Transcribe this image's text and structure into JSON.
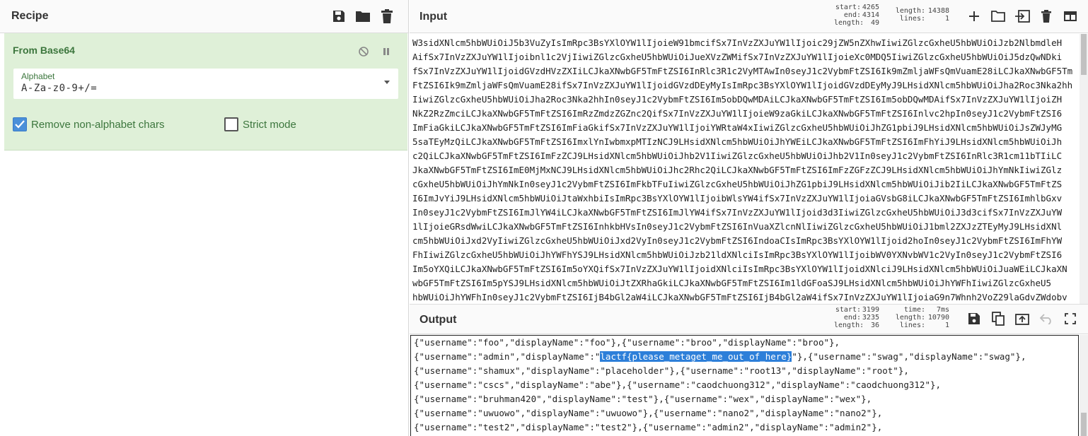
{
  "recipe": {
    "title": "Recipe",
    "actions": [
      "save-icon",
      "folder-icon",
      "trash-icon"
    ]
  },
  "operation": {
    "title": "From Base64",
    "alphabet_label": "Alphabet",
    "alphabet_value": "A-Za-z0-9+/=",
    "remove_label": "Remove non-alphabet chars",
    "remove_checked": true,
    "strict_label": "Strict mode",
    "strict_checked": false
  },
  "input": {
    "title": "Input",
    "stats": {
      "start_k": "start:",
      "start_v": "4265",
      "end_k": "end:",
      "end_v": "4314",
      "length_k": "length:",
      "length_v": "49",
      "tlength_k": "length:",
      "tlength_v": "14388",
      "lines_k": "lines:",
      "lines_v": "1"
    },
    "lines": [
      "W3sidXNlcm5hbWUiOiJ5b3VuZyIsImRpc3BsYXlOYW1lIjoieW91bmcifSx7InVzZXJuYW1lIjoic29jZW5nZXhwIiwiZGlzcGxheU5hbWUiOiJzb2NlbmdleH",
      "AifSx7InVzZXJuYW1lIjoibnl1c2VjIiwiZGlzcGxheU5hbWUiOiJueXVzZWMifSx7InVzZXJuYW1lIjoieXc0MDQ5IiwiZGlzcGxheU5hbWUiOiJ5dzQwNDki",
      "fSx7InVzZXJuYW1lIjoidGVzdHVzZXIiLCJkaXNwbGF5TmFtZSI6InRlc3R1c2VyMTAwIn0seyJ1c2VybmFtZSI6Ik9mZmljaWFsQmVuamE28iLCJkaXNwbGF5Tm",
      "FtZSI6Ik9mZmljaWFsQmVuamE28ifSx7InVzZXJuYW1lIjoidGVzdDEyMyIsImRpc3BsYXlOYW1lIjoidGVzdDEyMyJ9LHsidXNlcm5hbWUiOiJha2Roc3Nka2hh",
      "IiwiZGlzcGxheU5hbWUiOiJha2Roc3Nka2hhIn0seyJ1c2VybmFtZSI6Im5obDQwMDAiLCJkaXNwbGF5TmFtZSI6Im5obDQwMDAifSx7InVzZXJuYW1lIjoiZH",
      "NkZ2RzZmciLCJkaXNwbGF5TmFtZSI6ImRzZmdzZGZnc2QifSx7InVzZXJuYW1lIjoieW9zaGkiLCJkaXNwbGF5TmFtZSI6Inlvc2hpIn0seyJ1c2VybmFtZSI6",
      "ImFiaGkiLCJkaXNwbGF5TmFtZSI6ImFiaGkifSx7InVzZXJuYW1lIjoiYWRtaW4xIiwiZGlzcGxheU5hbWUiOiJhZG1pbiJ9LHsidXNlcm5hbWUiOiJsZWJyMG",
      "5saTEyMzQiLCJkaXNwbGF5TmFtZSI6ImxlYnIwbmxpMTIzNCJ9LHsidXNlcm5hbWUiOiJhYWEiLCJkaXNwbGF5TmFtZSI6ImFhYiJ9LHsidXNlcm5hbWUiOiJh",
      "c2QiLCJkaXNwbGF5TmFtZSI6ImFzZCJ9LHsidXNlcm5hbWUiOiJhb2V1IiwiZGlzcGxheU5hbWUiOiJhb2V1In0seyJ1c2VybmFtZSI6InRlc3R1cm11bTIiLC",
      "JkaXNwbGF5TmFtZSI6ImE0MjMxNCJ9LHsidXNlcm5hbWUiOiJhc2Rhc2QiLCJkaXNwbGF5TmFtZSI6ImFzZGFzZCJ9LHsidXNlcm5hbWUiOiJhYmNkIiwiZGlz",
      "cGxheU5hbWUiOiJhYmNkIn0seyJ1c2VybmFtZSI6ImFkbTFuIiwiZGlzcGxheU5hbWUiOiJhZG1pbiJ9LHsidXNlcm5hbWUiOiJib2IiLCJkaXNwbGF5TmFtZS",
      "I6ImJvYiJ9LHsidXNlcm5hbWUiOiJtaWxhbiIsImRpc3BsYXlOYW1lIjoibWlsYW4ifSx7InVzZXJuYW1lIjoiaGVsbG8iLCJkaXNwbGF5TmFtZSI6ImhlbGxv",
      "In0seyJ1c2VybmFtZSI6ImJlYW4iLCJkaXNwbGF5TmFtZSI6ImJlYW4ifSx7InVzZXJuYW1lIjoid3d3IiwiZGlzcGxheU5hbWUiOiJ3d3cifSx7InVzZXJuYW",
      "1lIjoieGRsdWwiLCJkaXNwbGF5TmFtZSI6InhkbHVsIn0seyJ1c2VybmFtZSI6InVuaXZlcnNlIiwiZGlzcGxheU5hbWUiOiJ1bml2ZXJzZTEyMyJ9LHsidXNl",
      "cm5hbWUiOiJxd2VyIiwiZGlzcGxheU5hbWUiOiJxd2VyIn0seyJ1c2VybmFtZSI6IndoaCIsImRpc3BsYXlOYW1lIjoid2hoIn0seyJ1c2VybmFtZSI6ImFhYW",
      "FhIiwiZGlzcGxheU5hbWUiOiJhYWFhYSJ9LHsidXNlcm5hbWUiOiJzb21ldXNlciIsImRpc3BsYXlOYW1lIjoibWV0YXNvbWV1c2VyIn0seyJ1c2VybmFtZSI6",
      "Im5oYXQiLCJkaXNwbGF5TmFtZSI6Im5oYXQifSx7InVzZXJuYW1lIjoidXNlciIsImRpc3BsYXlOYW1lIjoidXNlciJ9LHsidXNlcm5hbWUiOiJuaWEiLCJkaXN",
      "wbGF5TmFtZSI6Im5pYSJ9LHsidXNlcm5hbWUiOiJtZXRhaGkiLCJkaXNwbGF5TmFtZSI6Im1ldGFoaSJ9LHsidXNlcm5hbWUiOiJhYWFhIiwiZGlzcGxheU5",
      "hbWUiOiJhYWFhIn0seyJ1c2VybmFtZSI6IjB4bGl2aW4iLCJkaXNwbGF5TmFtZSI6IjB4bGl2aW4ifSx7InVzZXJuYW1lIjoiaG9n7Whnh2VoZ29laGdvZWdobv"
    ]
  },
  "output": {
    "title": "Output",
    "stats": {
      "start_k": "start:",
      "start_v": "3199",
      "end_k": "end:",
      "end_v": "3235",
      "length_k": "length:",
      "length_v": "36",
      "time_k": "time:",
      "time_v": "7ms",
      "tlength_k": "length:",
      "tlength_v": "10790",
      "lines_k": "lines:",
      "lines_v": "1"
    },
    "line1": "{\"username\":\"foo\",\"displayName\":\"foo\"},{\"username\":\"broo\",\"displayName\":\"broo\"},",
    "line2_pre": "{\"username\":\"admin\",\"displayName\":\"",
    "line2_hl": "lactf{please_metaget_me_out_of_here}",
    "line2_post": "\"},{\"username\":\"swag\",\"displayName\":\"swag\"},",
    "line3": "{\"username\":\"shamux\",\"displayName\":\"placeholder\"},{\"username\":\"root13\",\"displayName\":\"root\"},",
    "line4": "{\"username\":\"cscs\",\"displayName\":\"abe\"},{\"username\":\"caodchuong312\",\"displayName\":\"caodchuong312\"},",
    "line5": "{\"username\":\"bruhman420\",\"displayName\":\"test\"},{\"username\":\"wex\",\"displayName\":\"wex\"},",
    "line6": "{\"username\":\"uwuowo\",\"displayName\":\"uwuowo\"},{\"username\":\"nano2\",\"displayName\":\"nano2\"},",
    "line7": "{\"username\":\"test2\",\"displayName\":\"test2\"},{\"username\":\"admin2\",\"displayName\":\"admin2\"},"
  }
}
